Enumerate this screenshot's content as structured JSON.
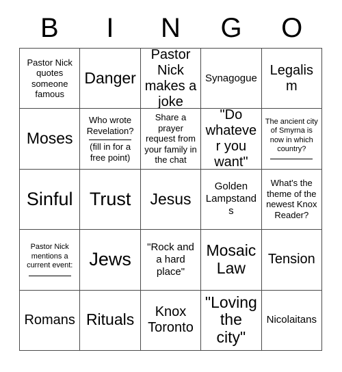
{
  "card": {
    "header_letters": [
      "B",
      "I",
      "N",
      "G",
      "O"
    ],
    "background_color": "#ffffff",
    "border_color": "#4a4a4a",
    "text_color": "#000000",
    "rows": 5,
    "columns": 5,
    "squares": [
      [
        {
          "text": "Pastor Nick quotes someone famous",
          "size": "sm",
          "blank_line": false
        },
        {
          "text": "Danger",
          "size": "xl",
          "blank_line": false
        },
        {
          "text": "Pastor Nick makes a joke",
          "size": "lg",
          "blank_line": false
        },
        {
          "text": "Synagogue",
          "size": "md",
          "blank_line": false
        },
        {
          "text": "Legalism",
          "size": "lg",
          "blank_line": false
        }
      ],
      [
        {
          "text": "Moses",
          "size": "xl",
          "blank_line": false
        },
        {
          "text": "Who wrote Revelation?",
          "text_after": "(fill in for a free point)",
          "size": "sm",
          "blank_line": true
        },
        {
          "text": "Share a prayer request from your family in the chat",
          "size": "sm",
          "blank_line": false
        },
        {
          "text": "\"Do whatever you want\"",
          "size": "lg",
          "blank_line": false
        },
        {
          "text": "The ancient city of Smyrna is now in which country?",
          "size": "xs",
          "blank_line": true
        }
      ],
      [
        {
          "text": "Sinful",
          "size": "xxl",
          "blank_line": false
        },
        {
          "text": "Trust",
          "size": "xxl",
          "blank_line": false
        },
        {
          "text": "Jesus",
          "size": "xl",
          "blank_line": false
        },
        {
          "text": "Golden Lampstands",
          "size": "md",
          "blank_line": false
        },
        {
          "text": "What's the theme of the newest Knox Reader?",
          "size": "sm",
          "blank_line": false
        }
      ],
      [
        {
          "text": "Pastor Nick mentions a current event:",
          "size": "xs",
          "blank_line": true
        },
        {
          "text": "Jews",
          "size": "xxl",
          "blank_line": false
        },
        {
          "text": "\"Rock and a hard place\"",
          "size": "md",
          "blank_line": false
        },
        {
          "text": "Mosaic Law",
          "size": "xl",
          "blank_line": false
        },
        {
          "text": "Tension",
          "size": "lg",
          "blank_line": false
        }
      ],
      [
        {
          "text": "Romans",
          "size": "lg",
          "blank_line": false
        },
        {
          "text": "Rituals",
          "size": "xl",
          "blank_line": false
        },
        {
          "text": "Knox Toronto",
          "size": "lg",
          "blank_line": false
        },
        {
          "text": "\"Loving the city\"",
          "size": "xl",
          "blank_line": false
        },
        {
          "text": "Nicolaitans",
          "size": "md",
          "blank_line": false
        }
      ]
    ]
  }
}
